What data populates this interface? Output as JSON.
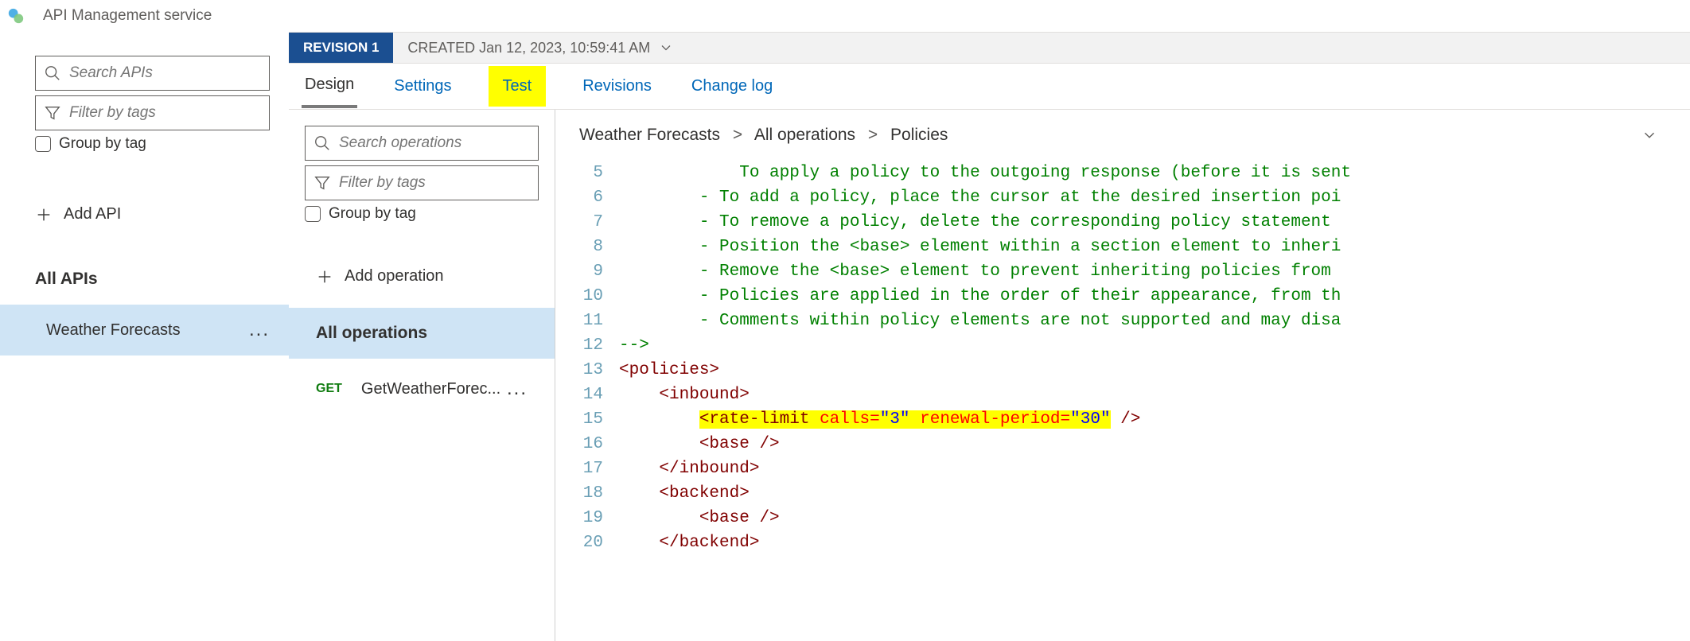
{
  "header": {
    "subtitle": "API Management service"
  },
  "apis": {
    "search_placeholder": "Search APIs",
    "filter_placeholder": "Filter by tags",
    "group_label": "Group by tag",
    "add_label": "Add API",
    "all_label": "All APIs",
    "items": [
      {
        "name": "Weather Forecasts"
      }
    ]
  },
  "revision": {
    "badge": "REVISION 1",
    "created_prefix": "CREATED",
    "created": "Jan 12, 2023, 10:59:41 AM"
  },
  "tabs": {
    "design": "Design",
    "settings": "Settings",
    "test": "Test",
    "revisions": "Revisions",
    "changelog": "Change log"
  },
  "ops": {
    "search_placeholder": "Search operations",
    "filter_placeholder": "Filter by tags",
    "group_label": "Group by tag",
    "add_label": "Add operation",
    "all_label": "All operations",
    "items": [
      {
        "method": "GET",
        "name": "GetWeatherForec..."
      }
    ]
  },
  "breadcrumb": {
    "a": "Weather Forecasts",
    "b": "All operations",
    "c": "Policies"
  },
  "code": {
    "first_line_no": 5,
    "lines": [
      {
        "type": "comment",
        "text": "        To apply a policy to the outgoing response (before it is sent"
      },
      {
        "type": "comment",
        "text": "    - To add a policy, place the cursor at the desired insertion poi"
      },
      {
        "type": "comment",
        "text": "    - To remove a policy, delete the corresponding policy statement "
      },
      {
        "type": "comment",
        "text": "    - Position the <base> element within a section element to inheri"
      },
      {
        "type": "comment",
        "text": "    - Remove the <base> element to prevent inheriting policies from "
      },
      {
        "type": "comment",
        "text": "    - Policies are applied in the order of their appearance, from th"
      },
      {
        "type": "comment",
        "text": "    - Comments within policy elements are not supported and may disa"
      },
      {
        "type": "comment-end",
        "text": "-->"
      },
      {
        "type": "tag",
        "indent": 0,
        "open": "<policies>"
      },
      {
        "type": "tag",
        "indent": 1,
        "open": "<inbound>"
      },
      {
        "type": "ratelimit",
        "indent": 2,
        "calls": "3",
        "renewal": "30"
      },
      {
        "type": "selfclose",
        "indent": 2,
        "open": "<base />"
      },
      {
        "type": "tag",
        "indent": 1,
        "open": "</inbound>"
      },
      {
        "type": "tag",
        "indent": 1,
        "open": "<backend>"
      },
      {
        "type": "selfclose",
        "indent": 2,
        "open": "<base />"
      },
      {
        "type": "tag-partial",
        "indent": 1,
        "open": "</backend>"
      }
    ]
  }
}
